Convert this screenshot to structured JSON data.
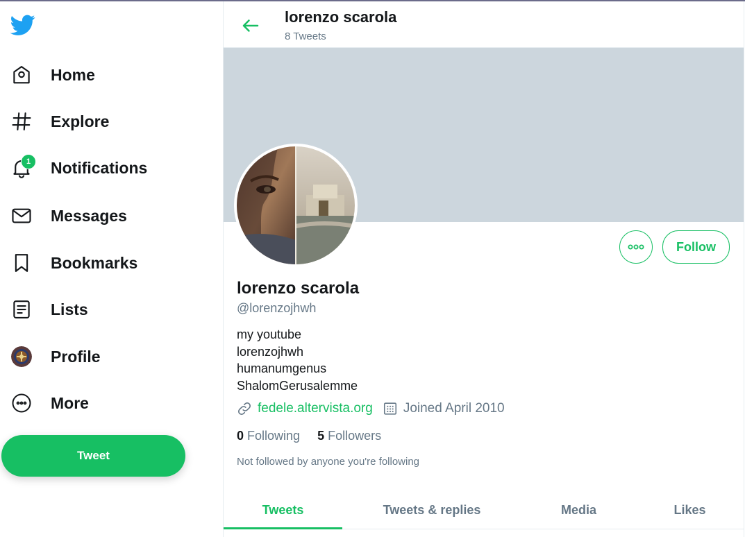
{
  "colors": {
    "accent": "#17bf63",
    "secondary_text": "#657786",
    "banner": "#ccd6dd"
  },
  "sidebar": {
    "logo": "twitter-bird-icon",
    "items": [
      {
        "label": "Home",
        "icon": "home-icon"
      },
      {
        "label": "Explore",
        "icon": "hashtag-icon"
      },
      {
        "label": "Notifications",
        "icon": "bell-icon",
        "badge": "1"
      },
      {
        "label": "Messages",
        "icon": "envelope-icon"
      },
      {
        "label": "Bookmarks",
        "icon": "bookmark-icon"
      },
      {
        "label": "Lists",
        "icon": "list-icon"
      },
      {
        "label": "Profile",
        "icon": "avatar"
      },
      {
        "label": "More",
        "icon": "more-circle-icon"
      }
    ],
    "tweet_button": "Tweet"
  },
  "header": {
    "name": "lorenzo scarola",
    "tweet_count": "8 Tweets"
  },
  "profile": {
    "name": "lorenzo scarola",
    "handle": "@lorenzojhwh",
    "bio_lines": [
      "my youtube",
      "lorenzojhwh",
      "humanumgenus",
      "ShalomGerusalemme"
    ],
    "website": "fedele.altervista.org",
    "joined": "Joined April 2010",
    "following_count": "0",
    "following_label": "Following",
    "followers_count": "5",
    "followers_label": "Followers",
    "not_followed_text": "Not followed by anyone you're following",
    "follow_button": "Follow"
  },
  "tabs": [
    {
      "label": "Tweets",
      "active": true
    },
    {
      "label": "Tweets & replies",
      "active": false
    },
    {
      "label": "Media",
      "active": false
    },
    {
      "label": "Likes",
      "active": false
    }
  ]
}
